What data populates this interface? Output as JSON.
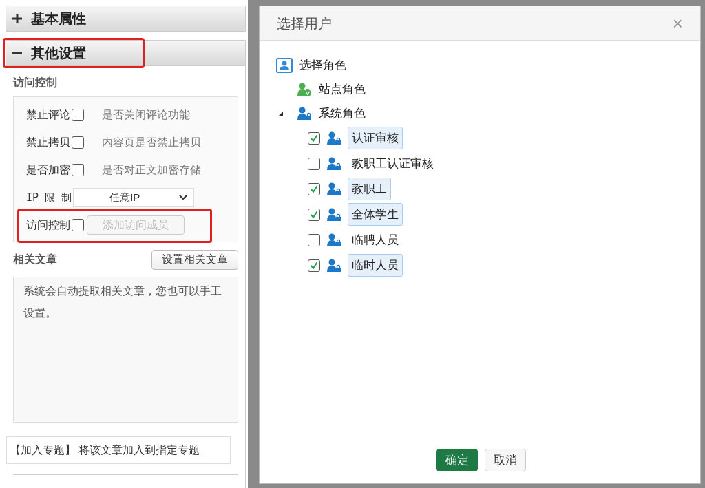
{
  "sections": [
    {
      "label": "基本属性",
      "expanded": false,
      "highlighted": false
    },
    {
      "label": "其他设置",
      "expanded": true,
      "highlighted": true
    }
  ],
  "access_control": {
    "title": "访问控制",
    "rows": [
      {
        "kind": "checkbox",
        "label": "禁止评论",
        "checked": false,
        "hint": "是否关闭评论功能"
      },
      {
        "kind": "checkbox",
        "label": "禁止拷贝",
        "checked": false,
        "hint": "内容页是否禁止拷贝"
      },
      {
        "kind": "checkbox",
        "label": "是否加密",
        "checked": false,
        "hint": "是否对正文加密存储"
      },
      {
        "kind": "select",
        "label": "IP 限 制",
        "value": "任意IP"
      },
      {
        "kind": "members",
        "label": "访问控制",
        "checked": false,
        "button": "添加访问成员",
        "disabled": true,
        "highlighted": true
      }
    ]
  },
  "related": {
    "title": "相关文章",
    "button": "设置相关文章",
    "text": "系统会自动提取相关文章，您也可以手工设置。"
  },
  "topic": "【加入专题】 将该文章加入到指定专题",
  "dialog": {
    "title": "选择用户",
    "close": "×",
    "tree": {
      "label": "选择角色",
      "children": [
        {
          "kind": "site",
          "label": "站点角色"
        },
        {
          "kind": "system",
          "label": "系统角色",
          "expanded": true,
          "children": [
            {
              "label": "认证审核",
              "checked": true,
              "selected": true
            },
            {
              "label": "教职工认证审核",
              "checked": false,
              "selected": false
            },
            {
              "label": "教职工",
              "checked": true,
              "selected": true
            },
            {
              "label": "全体学生",
              "checked": true,
              "selected": true
            },
            {
              "label": "临聘人员",
              "checked": false,
              "selected": false
            },
            {
              "label": "临时人员",
              "checked": true,
              "selected": true
            }
          ]
        }
      ]
    },
    "buttons": [
      {
        "kind": "primary",
        "label": "确定"
      },
      {
        "kind": "secondary",
        "label": "取消"
      }
    ]
  }
}
